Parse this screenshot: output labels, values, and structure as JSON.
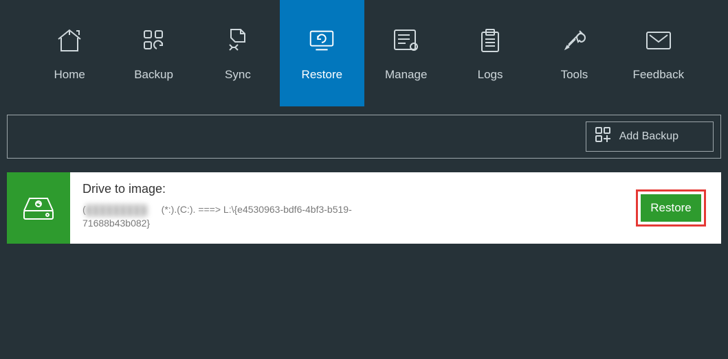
{
  "nav": {
    "items": [
      {
        "label": "Home"
      },
      {
        "label": "Backup"
      },
      {
        "label": "Sync"
      },
      {
        "label": "Restore"
      },
      {
        "label": "Manage"
      },
      {
        "label": "Logs"
      },
      {
        "label": "Tools"
      },
      {
        "label": "Feedback"
      }
    ],
    "active_index": 3
  },
  "toolbar": {
    "add_backup_label": "Add Backup"
  },
  "entry": {
    "title": "Drive to image:",
    "detail_obscured": "█████████",
    "detail_rest": "(*:).(C:). ===> L:\\{e4530963-bdf6-4bf3-b519-71688b43b082}",
    "restore_label": "Restore"
  }
}
